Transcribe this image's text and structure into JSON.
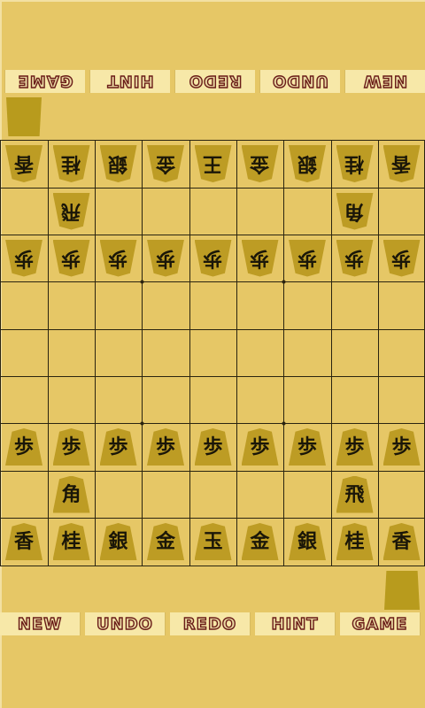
{
  "top_toolbar": {
    "buttons": [
      "NEW",
      "UNDO",
      "REDO",
      "HINT",
      "GAME"
    ]
  },
  "bottom_toolbar": {
    "buttons": [
      "NEW",
      "UNDO",
      "REDO",
      "HINT",
      "GAME"
    ]
  },
  "board": {
    "rows": 9,
    "cols": 9,
    "pieces": [
      {
        "row": 0,
        "col": 0,
        "char": "香",
        "owner": "gote",
        "name": "lance"
      },
      {
        "row": 0,
        "col": 1,
        "char": "桂",
        "owner": "gote",
        "name": "knight"
      },
      {
        "row": 0,
        "col": 2,
        "char": "銀",
        "owner": "gote",
        "name": "silver"
      },
      {
        "row": 0,
        "col": 3,
        "char": "金",
        "owner": "gote",
        "name": "gold"
      },
      {
        "row": 0,
        "col": 4,
        "char": "王",
        "owner": "gote",
        "name": "king"
      },
      {
        "row": 0,
        "col": 5,
        "char": "金",
        "owner": "gote",
        "name": "gold"
      },
      {
        "row": 0,
        "col": 6,
        "char": "銀",
        "owner": "gote",
        "name": "silver"
      },
      {
        "row": 0,
        "col": 7,
        "char": "桂",
        "owner": "gote",
        "name": "knight"
      },
      {
        "row": 0,
        "col": 8,
        "char": "香",
        "owner": "gote",
        "name": "lance"
      },
      {
        "row": 1,
        "col": 1,
        "char": "飛",
        "owner": "gote",
        "name": "rook"
      },
      {
        "row": 1,
        "col": 7,
        "char": "角",
        "owner": "gote",
        "name": "bishop"
      },
      {
        "row": 2,
        "col": 0,
        "char": "歩",
        "owner": "gote",
        "name": "pawn"
      },
      {
        "row": 2,
        "col": 1,
        "char": "歩",
        "owner": "gote",
        "name": "pawn"
      },
      {
        "row": 2,
        "col": 2,
        "char": "歩",
        "owner": "gote",
        "name": "pawn"
      },
      {
        "row": 2,
        "col": 3,
        "char": "歩",
        "owner": "gote",
        "name": "pawn"
      },
      {
        "row": 2,
        "col": 4,
        "char": "歩",
        "owner": "gote",
        "name": "pawn"
      },
      {
        "row": 2,
        "col": 5,
        "char": "歩",
        "owner": "gote",
        "name": "pawn"
      },
      {
        "row": 2,
        "col": 6,
        "char": "歩",
        "owner": "gote",
        "name": "pawn"
      },
      {
        "row": 2,
        "col": 7,
        "char": "歩",
        "owner": "gote",
        "name": "pawn"
      },
      {
        "row": 2,
        "col": 8,
        "char": "歩",
        "owner": "gote",
        "name": "pawn"
      },
      {
        "row": 6,
        "col": 0,
        "char": "歩",
        "owner": "sente",
        "name": "pawn"
      },
      {
        "row": 6,
        "col": 1,
        "char": "歩",
        "owner": "sente",
        "name": "pawn"
      },
      {
        "row": 6,
        "col": 2,
        "char": "歩",
        "owner": "sente",
        "name": "pawn"
      },
      {
        "row": 6,
        "col": 3,
        "char": "歩",
        "owner": "sente",
        "name": "pawn"
      },
      {
        "row": 6,
        "col": 4,
        "char": "歩",
        "owner": "sente",
        "name": "pawn"
      },
      {
        "row": 6,
        "col": 5,
        "char": "歩",
        "owner": "sente",
        "name": "pawn"
      },
      {
        "row": 6,
        "col": 6,
        "char": "歩",
        "owner": "sente",
        "name": "pawn"
      },
      {
        "row": 6,
        "col": 7,
        "char": "歩",
        "owner": "sente",
        "name": "pawn"
      },
      {
        "row": 6,
        "col": 8,
        "char": "歩",
        "owner": "sente",
        "name": "pawn"
      },
      {
        "row": 7,
        "col": 1,
        "char": "角",
        "owner": "sente",
        "name": "bishop"
      },
      {
        "row": 7,
        "col": 7,
        "char": "飛",
        "owner": "sente",
        "name": "rook"
      },
      {
        "row": 8,
        "col": 0,
        "char": "香",
        "owner": "sente",
        "name": "lance"
      },
      {
        "row": 8,
        "col": 1,
        "char": "桂",
        "owner": "sente",
        "name": "knight"
      },
      {
        "row": 8,
        "col": 2,
        "char": "銀",
        "owner": "sente",
        "name": "silver"
      },
      {
        "row": 8,
        "col": 3,
        "char": "金",
        "owner": "sente",
        "name": "gold"
      },
      {
        "row": 8,
        "col": 4,
        "char": "玉",
        "owner": "sente",
        "name": "king"
      },
      {
        "row": 8,
        "col": 5,
        "char": "金",
        "owner": "sente",
        "name": "gold"
      },
      {
        "row": 8,
        "col": 6,
        "char": "銀",
        "owner": "sente",
        "name": "silver"
      },
      {
        "row": 8,
        "col": 7,
        "char": "桂",
        "owner": "sente",
        "name": "knight"
      },
      {
        "row": 8,
        "col": 8,
        "char": "香",
        "owner": "sente",
        "name": "lance"
      }
    ]
  },
  "colors": {
    "background": "#e6c766",
    "piece": "#bd9c24",
    "grid_line": "#2a2410",
    "button_face": "#f7e8a8",
    "button_text_outline": "#6a1c18"
  }
}
